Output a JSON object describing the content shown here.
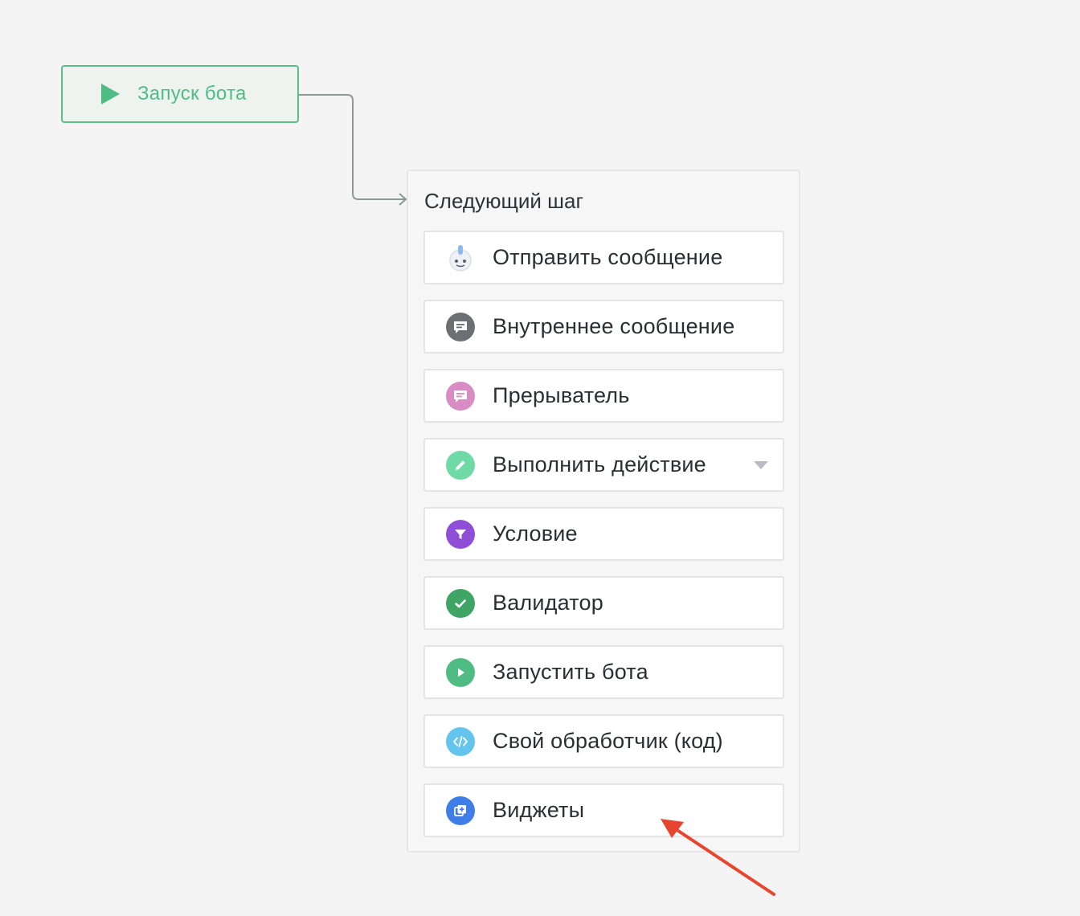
{
  "start_node": {
    "label": "Запуск бота",
    "icon": "play-icon"
  },
  "panel": {
    "title": "Следующий шаг",
    "items": [
      {
        "label": "Отправить сообщение",
        "icon": "robot-icon"
      },
      {
        "label": "Внутреннее сообщение",
        "icon": "chat-gray-icon"
      },
      {
        "label": "Прерыватель",
        "icon": "chat-pink-icon"
      },
      {
        "label": "Выполнить действие",
        "icon": "pencil-icon",
        "has_dropdown": true
      },
      {
        "label": "Условие",
        "icon": "filter-icon"
      },
      {
        "label": "Валидатор",
        "icon": "check-icon"
      },
      {
        "label": "Запустить бота",
        "icon": "play-circle-icon"
      },
      {
        "label": "Свой обработчик (код)",
        "icon": "code-icon"
      },
      {
        "label": "Виджеты",
        "icon": "widget-icon"
      }
    ]
  },
  "colors": {
    "start_border": "#5bbd8a",
    "start_text": "#4fbc84",
    "annotation_arrow": "#e8452f",
    "icon_gray": "#6d6f73",
    "icon_pink": "#d98bc4",
    "icon_green_light": "#6fdaa6",
    "icon_purple": "#8e4fd6",
    "icon_green": "#3fa565",
    "icon_teal": "#4fbc84",
    "icon_sky": "#63c4ee",
    "icon_blue": "#3f7ee6"
  }
}
